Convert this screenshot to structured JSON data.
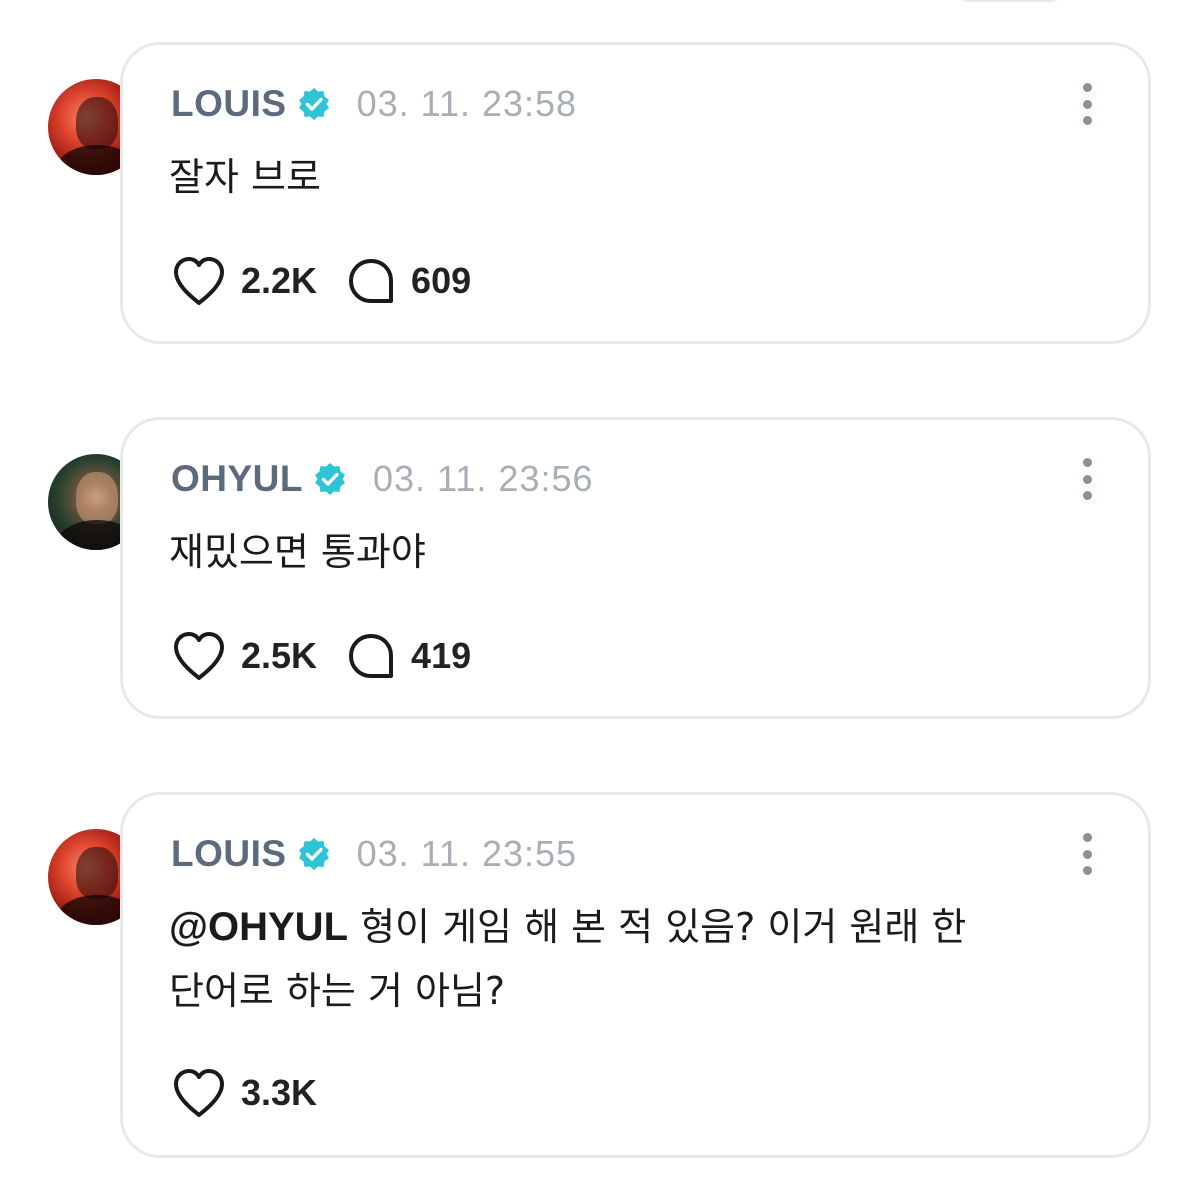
{
  "posts": [
    {
      "username": "LOUIS",
      "timestamp": "03. 11. 23:58",
      "text": "잘자 브로",
      "likes": "2.2K",
      "comments": "609",
      "avatar_icon": "louis-avatar",
      "avatar_color": "#c8301f"
    },
    {
      "username": "OHYUL",
      "timestamp": "03. 11. 23:56",
      "text": "재밌으면 통과야",
      "likes": "2.5K",
      "comments": "419",
      "avatar_icon": "ohyul-avatar",
      "avatar_color": "#1f3a27"
    },
    {
      "username": "LOUIS",
      "timestamp": "03. 11. 23:55",
      "mention": "@OHYUL",
      "text_line1": " 형이 게임 해 본 적 있음? 이거 원래 한",
      "text_line2": "단어로 하는 거 아님?",
      "likes": "3.3K",
      "avatar_icon": "louis-avatar",
      "avatar_color": "#c8301f"
    }
  ],
  "icons": {
    "verified": "verified-badge-icon",
    "like": "heart-icon",
    "comment": "comment-bubble-icon",
    "more": "more-vertical-icon"
  },
  "colors": {
    "verified": "#2ec4d6",
    "username": "#5b6b7d",
    "timestamp": "#a8aeb6",
    "card_border": "#e6e8ec"
  }
}
